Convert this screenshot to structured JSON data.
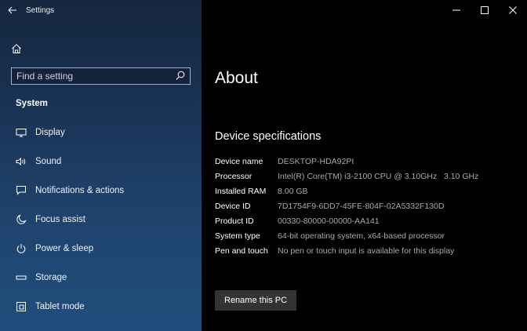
{
  "window": {
    "app_title": "Settings"
  },
  "sidebar": {
    "search_placeholder": "Find a setting",
    "section_header": "System",
    "items": [
      {
        "label": "Display",
        "icon": "display-icon"
      },
      {
        "label": "Sound",
        "icon": "sound-icon"
      },
      {
        "label": "Notifications & actions",
        "icon": "notifications-icon"
      },
      {
        "label": "Focus assist",
        "icon": "focus-assist-icon"
      },
      {
        "label": "Power & sleep",
        "icon": "power-icon"
      },
      {
        "label": "Storage",
        "icon": "storage-icon"
      },
      {
        "label": "Tablet mode",
        "icon": "tablet-mode-icon"
      }
    ]
  },
  "main": {
    "page_title": "About",
    "section_title": "Device specifications",
    "specs": [
      {
        "label": "Device name",
        "value": "DESKTOP-HDA92PI"
      },
      {
        "label": "Processor",
        "value": "Intel(R) Core(TM) i3-2100 CPU @ 3.10GHz   3.10 GHz"
      },
      {
        "label": "Installed RAM",
        "value": "8.00 GB"
      },
      {
        "label": "Device ID",
        "value": "7D1754F9-6DD7-45FE-804F-02A5332F130D"
      },
      {
        "label": "Product ID",
        "value": "00330-80000-00000-AA141"
      },
      {
        "label": "System type",
        "value": "64-bit operating system, x64-based processor"
      },
      {
        "label": "Pen and touch",
        "value": "No pen or touch input is available for this display"
      }
    ],
    "rename_button": "Rename this PC"
  },
  "colors": {
    "sidebar_top": "#15263f",
    "sidebar_bottom": "#214d7c",
    "main_background": "#000000",
    "value_text": "#a9a9a9",
    "button_background": "#333333"
  }
}
